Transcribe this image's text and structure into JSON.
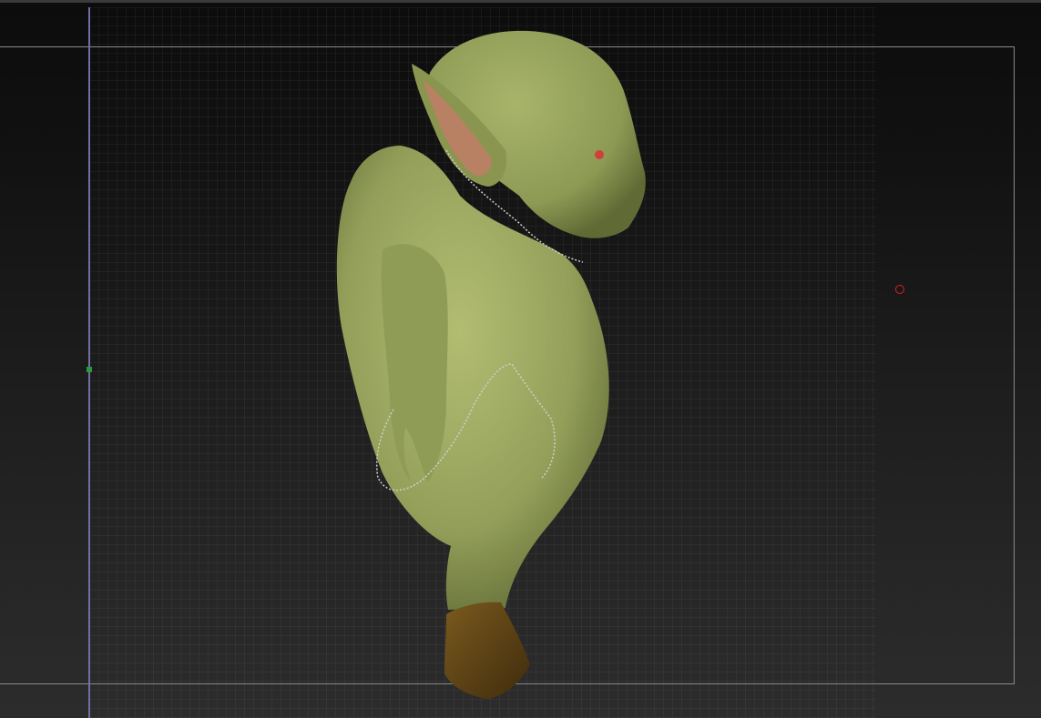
{
  "app": {
    "name": ""
  },
  "viewport": {
    "model": {
      "icon": "goblin-sculpt-model",
      "skin_color": "#9aa65a",
      "boot_color": "#5a4014"
    },
    "colors": {
      "background_top": "#0c0c0c",
      "background_bottom": "#2c2c2c",
      "grid": "#969696",
      "frame": "#8a8a8a",
      "axis": "#6f6fa8",
      "pivot": "#d92020"
    }
  }
}
